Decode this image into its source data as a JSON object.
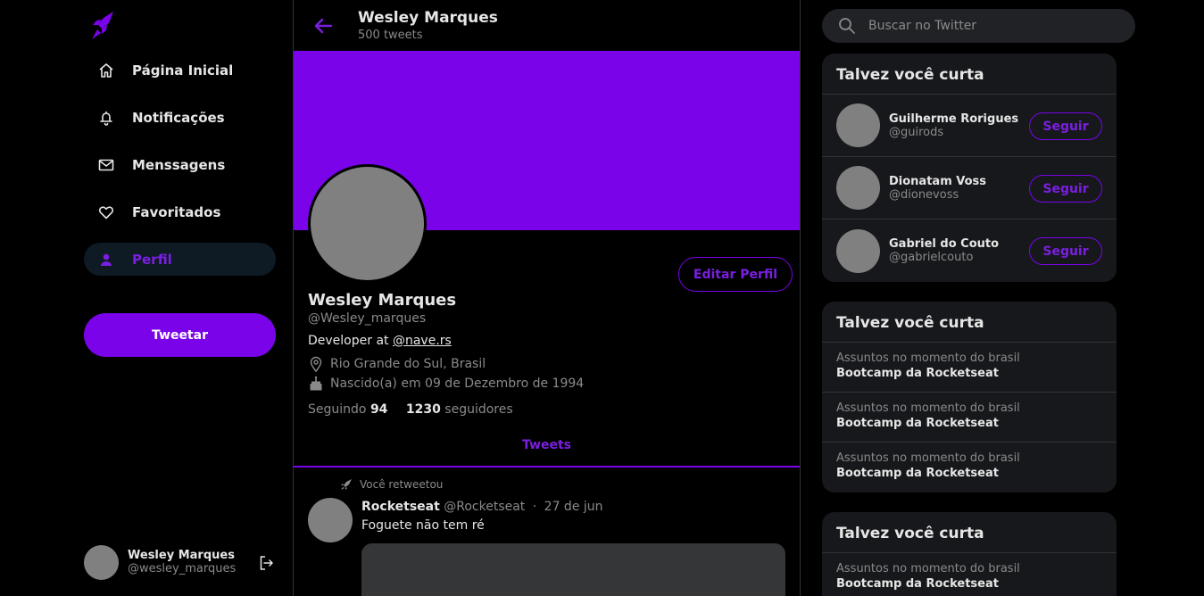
{
  "colors": {
    "accent": "#7a03ea",
    "background": "#000000",
    "card": "#17181b"
  },
  "nav": {
    "items": [
      {
        "label": "Página Inicial",
        "icon": "home-icon"
      },
      {
        "label": "Notificações",
        "icon": "bell-icon"
      },
      {
        "label": "Menssagens",
        "icon": "mail-icon"
      },
      {
        "label": "Favoritados",
        "icon": "heart-icon"
      },
      {
        "label": "Perfil",
        "icon": "user-icon",
        "active": true
      }
    ],
    "tweet_button": "Tweetar"
  },
  "account": {
    "name": "Wesley Marques",
    "handle": "@wesley_marques"
  },
  "header": {
    "title": "Wesley Marques",
    "subtitle": "500 tweets"
  },
  "profile": {
    "edit_button": "Editar Perfil",
    "name": "Wesley Marques",
    "handle": "@Wesley_marques",
    "bio_prefix": "Developer at ",
    "bio_link": "@nave.rs",
    "location": "Rio Grande do Sul, Brasil",
    "birth": "Nascido(a) em 09 de Dezembro de 1994",
    "following_label": "Seguindo",
    "following_count": "94",
    "followers_count": "1230",
    "followers_label": "seguidores"
  },
  "tabs": {
    "tweets": "Tweets"
  },
  "post": {
    "retweet_label": "Você retweetou",
    "name": "Rocketseat",
    "handle": "@Rocketseat",
    "separator": "·",
    "date": "27 de jun",
    "text": "Foguete não tem ré"
  },
  "search": {
    "placeholder": "Buscar no Twitter"
  },
  "who_to_follow": {
    "title": "Talvez você curta",
    "follow_label": "Seguir",
    "users": [
      {
        "name": "Guilherme Rorigues",
        "handle": "@guirods"
      },
      {
        "name": "Dionatam Voss",
        "handle": "@dionevoss"
      },
      {
        "name": "Gabriel do Couto",
        "handle": "@gabrielcouto"
      }
    ]
  },
  "trends_card_1": {
    "title": "Talvez você curta",
    "items": [
      {
        "context": "Assuntos no momento do brasil",
        "topic": "Bootcamp da Rocketseat"
      },
      {
        "context": "Assuntos no momento do brasil",
        "topic": "Bootcamp da Rocketseat"
      },
      {
        "context": "Assuntos no momento do brasil",
        "topic": "Bootcamp da Rocketseat"
      }
    ]
  },
  "trends_card_2": {
    "title": "Talvez você curta",
    "items": [
      {
        "context": "Assuntos no momento do brasil",
        "topic": "Bootcamp da Rocketseat"
      }
    ]
  }
}
